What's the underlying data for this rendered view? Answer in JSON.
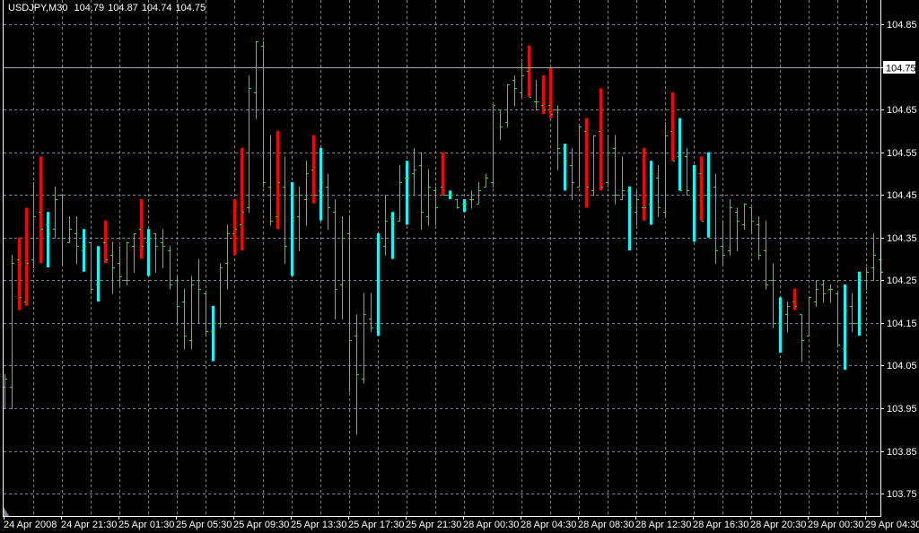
{
  "header": {
    "symbol": "USDJPY,M30",
    "open": "104.79",
    "high": "104.87",
    "low": "104.74",
    "close": "104.75"
  },
  "colors": {
    "background": "#000000",
    "grid": "#778899",
    "bar": "#00ff00",
    "highlight_down": "#ff0000",
    "highlight_up": "#00ffff",
    "price_line": "#a0a8b0",
    "axis": "#ffffff"
  },
  "chart_data": {
    "type": "ohlc",
    "title": "USDJPY,M30",
    "grid": true,
    "ylim": [
      103.69,
      104.906
    ],
    "current_price": "104.75",
    "y_ticks": [
      "104.85",
      "104.75",
      "104.65",
      "104.55",
      "104.45",
      "104.35",
      "104.25",
      "104.15",
      "104.05",
      "103.95",
      "103.85",
      "103.75"
    ],
    "x_ticks": [
      "24 Apr 2008",
      "24 Apr 21:30",
      "25 Apr 01:30",
      "25 Apr 05:30",
      "25 Apr 09:30",
      "25 Apr 13:30",
      "25 Apr 17:30",
      "25 Apr 21:30",
      "28 Apr 00:30",
      "28 Apr 04:30",
      "28 Apr 08:30",
      "28 Apr 12:30",
      "28 Apr 16:30",
      "28 Apr 20:30",
      "29 Apr 00:30",
      "29 Apr 04:30"
    ],
    "bar_fields": [
      "style",
      "open",
      "high",
      "low",
      "close"
    ],
    "bars": [
      [
        "g",
        104.0,
        104.03,
        103.95,
        104.02
      ],
      [
        "g",
        104.0,
        104.31,
        103.95,
        104.29
      ],
      [
        "r",
        104.3,
        104.35,
        104.18,
        104.21
      ],
      [
        "r",
        104.2,
        104.42,
        104.19,
        104.29
      ],
      [
        "g",
        104.3,
        104.48,
        104.28,
        104.4
      ],
      [
        "r",
        104.41,
        104.54,
        104.29,
        104.37
      ],
      [
        "c",
        104.38,
        104.41,
        104.28,
        104.36
      ],
      [
        "g",
        104.37,
        104.47,
        104.35,
        104.44
      ],
      [
        "g",
        104.45,
        104.45,
        104.29,
        104.35
      ],
      [
        "g",
        104.34,
        104.4,
        104.34,
        104.37
      ],
      [
        "g",
        104.36,
        104.4,
        104.29,
        104.33
      ],
      [
        "c",
        104.32,
        104.37,
        104.27,
        104.33
      ],
      [
        "g",
        104.34,
        104.34,
        104.22,
        104.23
      ],
      [
        "c",
        104.24,
        104.33,
        104.2,
        104.25
      ],
      [
        "r",
        104.34,
        104.39,
        104.29,
        104.3
      ],
      [
        "g",
        104.31,
        104.34,
        104.22,
        104.28
      ],
      [
        "g",
        104.29,
        104.33,
        104.24,
        104.26
      ],
      [
        "g",
        104.25,
        104.34,
        104.24,
        104.34
      ],
      [
        "g",
        104.33,
        104.36,
        104.27,
        104.36
      ],
      [
        "r",
        104.37,
        104.44,
        104.3,
        104.33
      ],
      [
        "c",
        104.34,
        104.37,
        104.26,
        104.35
      ],
      [
        "g",
        104.36,
        104.36,
        104.27,
        104.33
      ],
      [
        "g",
        104.34,
        104.37,
        104.28,
        104.33
      ],
      [
        "g",
        104.32,
        104.33,
        104.23,
        104.24
      ],
      [
        "g",
        104.25,
        104.26,
        104.15,
        104.19
      ],
      [
        "g",
        104.2,
        104.23,
        104.09,
        104.12
      ],
      [
        "g",
        104.11,
        104.26,
        104.09,
        104.24
      ],
      [
        "g",
        104.25,
        104.3,
        104.15,
        104.23
      ],
      [
        "g",
        104.22,
        104.22,
        104.12,
        104.13
      ],
      [
        "c",
        104.13,
        104.19,
        104.06,
        104.15
      ],
      [
        "g",
        104.15,
        104.29,
        104.14,
        104.28
      ],
      [
        "g",
        104.29,
        104.38,
        104.23,
        104.36
      ],
      [
        "r",
        104.36,
        104.44,
        104.31,
        104.37
      ],
      [
        "r",
        104.38,
        104.56,
        104.32,
        104.41
      ],
      [
        "g",
        104.42,
        104.73,
        104.41,
        104.7
      ],
      [
        "g",
        104.69,
        104.81,
        104.63,
        104.81
      ],
      [
        "g",
        104.8,
        104.81,
        104.47,
        104.48
      ],
      [
        "g",
        104.47,
        104.59,
        104.38,
        104.39
      ],
      [
        "r",
        104.4,
        104.6,
        104.37,
        104.48
      ],
      [
        "g",
        104.47,
        104.54,
        104.29,
        104.33
      ],
      [
        "c",
        104.45,
        104.48,
        104.26,
        104.39
      ],
      [
        "g",
        104.4,
        104.47,
        104.32,
        104.45
      ],
      [
        "g",
        104.44,
        104.53,
        104.38,
        104.5
      ],
      [
        "r",
        104.51,
        104.59,
        104.43,
        104.45
      ],
      [
        "c",
        104.46,
        104.56,
        104.39,
        104.48
      ],
      [
        "g",
        104.47,
        104.5,
        104.37,
        104.42
      ],
      [
        "g",
        104.41,
        104.44,
        104.16,
        104.23
      ],
      [
        "g",
        104.24,
        104.4,
        104.16,
        104.35
      ],
      [
        "g",
        104.36,
        104.4,
        103.99,
        104.11
      ],
      [
        "g",
        104.12,
        104.17,
        103.89,
        104.03
      ],
      [
        "g",
        104.02,
        104.22,
        104.01,
        104.17
      ],
      [
        "g",
        104.16,
        104.22,
        104.13,
        104.14
      ],
      [
        "c",
        104.14,
        104.36,
        104.12,
        104.34
      ],
      [
        "g",
        104.33,
        104.45,
        104.31,
        104.39
      ],
      [
        "c",
        104.4,
        104.41,
        104.3,
        104.38
      ],
      [
        "g",
        104.39,
        104.52,
        104.39,
        104.48
      ],
      [
        "c",
        104.49,
        104.53,
        104.38,
        104.49
      ],
      [
        "g",
        104.5,
        104.56,
        104.45,
        104.51
      ],
      [
        "g",
        104.52,
        104.55,
        104.37,
        104.41
      ],
      [
        "g",
        104.4,
        104.51,
        104.38,
        104.47
      ],
      [
        "g",
        104.46,
        104.47,
        104.38,
        104.42
      ],
      [
        "r",
        104.47,
        104.55,
        104.45,
        104.45
      ],
      [
        "c",
        104.45,
        104.46,
        104.44,
        104.45
      ],
      [
        "g",
        104.44,
        104.44,
        104.42,
        104.42
      ],
      [
        "c",
        104.43,
        104.44,
        104.41,
        104.43
      ],
      [
        "g",
        104.44,
        104.46,
        104.42,
        104.44
      ],
      [
        "g",
        104.43,
        104.48,
        104.43,
        104.46
      ],
      [
        "g",
        104.47,
        104.5,
        104.47,
        104.49
      ],
      [
        "g",
        104.48,
        104.66,
        104.47,
        104.66
      ],
      [
        "g",
        104.65,
        104.65,
        104.58,
        104.61
      ],
      [
        "g",
        104.62,
        104.71,
        104.61,
        104.71
      ],
      [
        "g",
        104.72,
        104.73,
        104.66,
        104.7
      ],
      [
        "g",
        104.69,
        104.76,
        104.68,
        104.73
      ],
      [
        "r",
        104.74,
        104.8,
        104.68,
        104.68
      ],
      [
        "g",
        104.67,
        104.72,
        104.65,
        104.67
      ],
      [
        "r",
        104.66,
        104.73,
        104.64,
        104.65
      ],
      [
        "r",
        104.66,
        104.75,
        104.63,
        104.64
      ],
      [
        "g",
        104.65,
        104.66,
        104.51,
        104.56
      ],
      [
        "c",
        104.56,
        104.57,
        104.46,
        104.53
      ],
      [
        "g",
        104.52,
        104.56,
        104.44,
        104.48
      ],
      [
        "g",
        104.47,
        104.61,
        104.47,
        104.61
      ],
      [
        "r",
        104.6,
        104.63,
        104.42,
        104.47
      ],
      [
        "g",
        104.46,
        104.59,
        104.45,
        104.59
      ],
      [
        "r",
        104.6,
        104.7,
        104.46,
        104.47
      ],
      [
        "g",
        104.48,
        104.59,
        104.47,
        104.55
      ],
      [
        "g",
        104.56,
        104.59,
        104.43,
        104.45
      ],
      [
        "g",
        104.44,
        104.54,
        104.44,
        104.46
      ],
      [
        "c",
        104.46,
        104.47,
        104.32,
        104.42
      ],
      [
        "g",
        104.41,
        104.46,
        104.38,
        104.44
      ],
      [
        "r",
        104.42,
        104.56,
        104.39,
        104.42
      ],
      [
        "c",
        104.43,
        104.53,
        104.38,
        104.5
      ],
      [
        "g",
        104.49,
        104.52,
        104.4,
        104.42
      ],
      [
        "g",
        104.41,
        104.62,
        104.4,
        104.59
      ],
      [
        "r",
        104.6,
        104.69,
        104.53,
        104.53
      ],
      [
        "c",
        104.54,
        104.63,
        104.46,
        104.46
      ],
      [
        "g",
        104.54,
        104.56,
        104.45,
        104.46
      ],
      [
        "c",
        104.45,
        104.52,
        104.34,
        104.51
      ],
      [
        "r",
        104.5,
        104.54,
        104.39,
        104.39
      ],
      [
        "c",
        104.45,
        104.55,
        104.35,
        104.46
      ],
      [
        "g",
        104.47,
        104.5,
        104.29,
        104.32
      ],
      [
        "g",
        104.33,
        104.39,
        104.29,
        104.31
      ],
      [
        "g",
        104.32,
        104.44,
        104.31,
        104.42
      ],
      [
        "g",
        104.41,
        104.42,
        104.32,
        104.39
      ],
      [
        "g",
        104.38,
        104.43,
        104.37,
        104.43
      ],
      [
        "g",
        104.42,
        104.42,
        104.36,
        104.39
      ],
      [
        "g",
        104.38,
        104.4,
        104.3,
        104.31
      ],
      [
        "g",
        104.32,
        104.39,
        104.23,
        104.24
      ],
      [
        "g",
        104.25,
        104.29,
        104.14,
        104.15
      ],
      [
        "c",
        104.15,
        104.21,
        104.08,
        104.19
      ],
      [
        "g",
        104.17,
        104.2,
        104.13,
        104.19
      ],
      [
        "r",
        104.2,
        104.23,
        104.18,
        104.19
      ],
      [
        "g",
        104.17,
        104.17,
        104.06,
        104.11
      ],
      [
        "g",
        104.12,
        104.21,
        104.12,
        104.21
      ],
      [
        "g",
        104.2,
        104.25,
        104.19,
        104.23
      ],
      [
        "g",
        104.24,
        104.25,
        104.2,
        104.22
      ],
      [
        "g",
        104.23,
        104.24,
        104.2,
        104.23
      ],
      [
        "g",
        104.22,
        104.22,
        104.1,
        104.1
      ],
      [
        "c",
        104.09,
        104.24,
        104.04,
        104.18
      ],
      [
        "g",
        104.19,
        104.22,
        104.13,
        104.15
      ],
      [
        "c",
        104.15,
        104.27,
        104.12,
        104.26
      ],
      [
        "g",
        104.25,
        104.28,
        104.23,
        104.27
      ],
      [
        "g",
        104.28,
        104.36,
        104.25,
        104.31
      ],
      [
        "g",
        104.3,
        104.31,
        104.25,
        104.27
      ]
    ]
  }
}
